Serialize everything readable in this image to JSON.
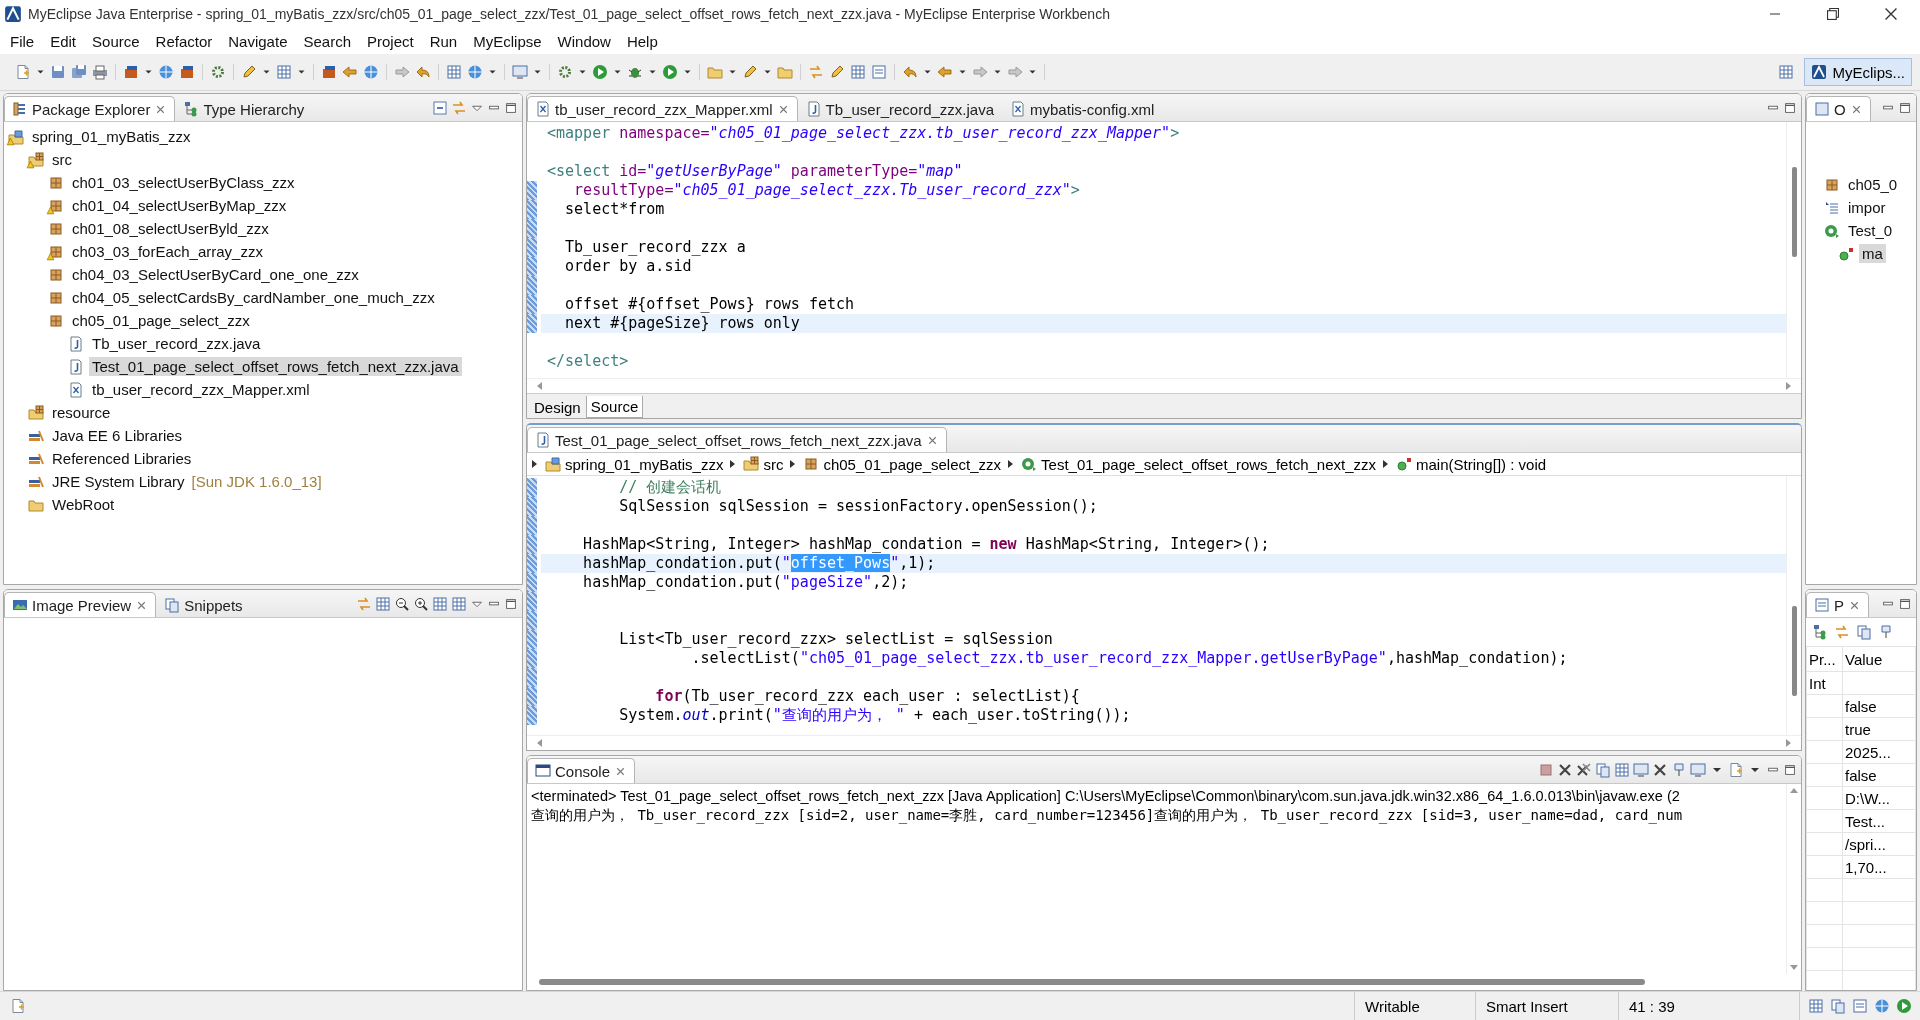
{
  "window": {
    "title": "MyEclipse Java Enterprise - spring_01_myBatis_zzx/src/ch05_01_page_select_zzx/Test_01_page_select_offset_rows_fetch_next_zzx.java - MyEclipse Enterprise Workbench"
  },
  "menu": [
    {
      "label": "File"
    },
    {
      "label": "Edit"
    },
    {
      "label": "Source"
    },
    {
      "label": "Refactor"
    },
    {
      "label": "Navigate"
    },
    {
      "label": "Search"
    },
    {
      "label": "Project"
    },
    {
      "label": "Run"
    },
    {
      "label": "MyEclipse"
    },
    {
      "label": "Window"
    },
    {
      "label": "Help"
    }
  ],
  "perspective": {
    "label": "MyEclips...",
    "selected": true
  },
  "explorer": {
    "tabs": [
      {
        "label": "Package Explorer",
        "kind": "explorer",
        "selected": true
      },
      {
        "label": "Type Hierarchy",
        "kind": "hierarchy",
        "selected": false
      }
    ],
    "tree": [
      {
        "label": "spring_01_myBatis_zzx",
        "kind": "project",
        "warning": true,
        "selected": false,
        "children": [
          {
            "label": "src",
            "kind": "srcfolder",
            "warning": true,
            "selected": false,
            "children": [
              {
                "label": "ch01_03_selectUserByClass_zzx",
                "kind": "package",
                "warning": false,
                "selected": false
              },
              {
                "label": "ch01_04_selectUserByMap_zzx",
                "kind": "package",
                "warning": true,
                "selected": false
              },
              {
                "label": "ch01_08_selectUserByld_zzx",
                "kind": "package",
                "warning": false,
                "selected": false
              },
              {
                "label": "ch03_03_forEach_array_zzx",
                "kind": "package",
                "warning": true,
                "selected": false
              },
              {
                "label": "ch04_03_SelectUserByCard_one_one_zzx",
                "kind": "package",
                "warning": false,
                "selected": false
              },
              {
                "label": "ch04_05_selectCardsBy_cardNamber_one_much_zzx",
                "kind": "package",
                "warning": false,
                "selected": false
              },
              {
                "label": "ch05_01_page_select_zzx",
                "kind": "package",
                "warning": false,
                "selected": false,
                "children": [
                  {
                    "label": "Tb_user_record_zzx.java",
                    "kind": "java",
                    "warning": false,
                    "selected": false
                  },
                  {
                    "label": "Test_01_page_select_offset_rows_fetch_next_zzx.java",
                    "kind": "java",
                    "warning": false,
                    "selected": true
                  },
                  {
                    "label": "tb_user_record_zzx_Mapper.xml",
                    "kind": "xml",
                    "warning": false,
                    "selected": false
                  }
                ]
              }
            ]
          },
          {
            "label": "resource",
            "kind": "srcfolder",
            "warning": false,
            "selected": false
          },
          {
            "label": "Java EE 6 Libraries",
            "kind": "library",
            "warning": false,
            "selected": false
          },
          {
            "label": "Referenced Libraries",
            "kind": "library",
            "warning": false,
            "selected": false
          },
          {
            "label": "JRE System Library",
            "decoration": "[Sun JDK 1.6.0_13]",
            "kind": "library",
            "warning": false,
            "selected": false
          },
          {
            "label": "WebRoot",
            "kind": "folder",
            "warning": false,
            "selected": false
          }
        ]
      }
    ]
  },
  "preview": {
    "tabs": [
      {
        "label": "Image Preview",
        "kind": "image",
        "selected": true
      },
      {
        "label": "Snippets",
        "kind": "snippets",
        "selected": false
      }
    ]
  },
  "xml_editor": {
    "tabs": [
      {
        "label": "tb_user_record_zzx_Mapper.xml",
        "kind": "xml",
        "selected": true
      },
      {
        "label": "Tb_user_record_zzx.java",
        "kind": "java",
        "selected": false
      },
      {
        "label": "mybatis-config.xml",
        "kind": "xml",
        "selected": false
      }
    ],
    "lines": [
      {
        "current": false,
        "changed": false,
        "tokens": [
          {
            "text": "<mapper",
            "kind": "tag"
          },
          {
            "text": " namespace=",
            "kind": "attr"
          },
          {
            "text": "\"ch05_01_page_select_zzx.tb_user_record_zzx_Mapper\"",
            "kind": "val"
          },
          {
            "text": ">",
            "kind": "tag"
          }
        ]
      },
      {
        "current": false,
        "changed": false
      },
      {
        "current": false,
        "changed": false,
        "tokens": [
          {
            "text": "<select",
            "kind": "tag"
          },
          {
            "text": " id=",
            "kind": "attr"
          },
          {
            "text": "\"getUserByPage\"",
            "kind": "val"
          },
          {
            "text": " parameterType=",
            "kind": "attr"
          },
          {
            "text": "\"map\"",
            "kind": "val"
          }
        ]
      },
      {
        "current": false,
        "changed": true,
        "tokens": [
          {
            "text": "   resultType=",
            "kind": "attr"
          },
          {
            "text": "\"ch05_01_page_select_zzx.Tb_user_record_zzx\"",
            "kind": "val"
          },
          {
            "text": ">",
            "kind": "tag"
          }
        ]
      },
      {
        "current": false,
        "changed": true,
        "tokens": [
          {
            "text": "  select*from",
            "kind": "plain"
          }
        ]
      },
      {
        "current": false,
        "changed": true
      },
      {
        "current": false,
        "changed": true,
        "tokens": [
          {
            "text": "  Tb_user_record_zzx a",
            "kind": "plain"
          }
        ]
      },
      {
        "current": false,
        "changed": true,
        "tokens": [
          {
            "text": "  order by a.sid",
            "kind": "plain"
          }
        ]
      },
      {
        "current": false,
        "changed": true
      },
      {
        "current": false,
        "changed": true,
        "tokens": [
          {
            "text": "  offset #{offset_Pows} rows fetch",
            "kind": "plain"
          }
        ]
      },
      {
        "current": true,
        "changed": true,
        "tokens": [
          {
            "text": "  next #{pageSize} rows only",
            "kind": "plain"
          }
        ]
      },
      {
        "current": false,
        "changed": false
      },
      {
        "current": false,
        "changed": false,
        "tokens": [
          {
            "text": "</select>",
            "kind": "tag"
          }
        ]
      }
    ],
    "views": [
      {
        "label": "Design",
        "selected": false
      },
      {
        "label": "Source",
        "selected": true
      }
    ]
  },
  "java_editor": {
    "tabs": [
      {
        "label": "Test_01_page_select_offset_rows_fetch_next_zzx.java",
        "kind": "java",
        "selected": true
      }
    ],
    "breadcrumb": [
      {
        "label": "spring_01_myBatis_zzx",
        "kind": "project"
      },
      {
        "label": "src",
        "kind": "srcfolder"
      },
      {
        "label": "ch05_01_page_select_zzx",
        "kind": "package"
      },
      {
        "label": "Test_01_page_select_offset_rows_fetch_next_zzx",
        "kind": "class"
      },
      {
        "label": "main(String[]) : void",
        "kind": "method"
      }
    ],
    "lines": [
      {
        "current": false,
        "changed": true,
        "tokens": [
          {
            "text": "        // 创建会话机",
            "kind": "comment"
          }
        ]
      },
      {
        "current": false,
        "changed": true,
        "tokens": [
          {
            "text": "        SqlSession sqlSession = sessionFactory.openSession();",
            "kind": "plain"
          }
        ]
      },
      {
        "current": false,
        "changed": true
      },
      {
        "current": false,
        "changed": true,
        "tokens": [
          {
            "text": "    HashMap<String, Integer> hashMap_condation = ",
            "kind": "plain"
          },
          {
            "text": "new",
            "kind": "kw"
          },
          {
            "text": " HashMap<String, Integer>();",
            "kind": "plain"
          }
        ]
      },
      {
        "current": true,
        "changed": true,
        "tokens": [
          {
            "text": "    hashMap_condation.put(",
            "kind": "plain"
          },
          {
            "text": "\"",
            "kind": "str"
          },
          {
            "text": "offset_Pows",
            "kind": "sel"
          },
          {
            "text": "\"",
            "kind": "str"
          },
          {
            "text": ",1);",
            "kind": "plain"
          }
        ]
      },
      {
        "current": false,
        "changed": true,
        "tokens": [
          {
            "text": "    hashMap_condation.put(",
            "kind": "plain"
          },
          {
            "text": "\"pageSize\"",
            "kind": "str"
          },
          {
            "text": ",2);",
            "kind": "plain"
          }
        ]
      },
      {
        "current": false,
        "changed": true
      },
      {
        "current": false,
        "changed": true
      },
      {
        "current": false,
        "changed": true,
        "tokens": [
          {
            "text": "        List<Tb_user_record_zzx> selectList = sqlSession",
            "kind": "plain"
          }
        ]
      },
      {
        "current": false,
        "changed": true,
        "tokens": [
          {
            "text": "                .selectList(",
            "kind": "plain"
          },
          {
            "text": "\"ch05_01_page_select_zzx.tb_user_record_zzx_Mapper.getUserByPage\"",
            "kind": "str"
          },
          {
            "text": ",hashMap_condation);",
            "kind": "plain"
          }
        ]
      },
      {
        "current": false,
        "changed": true
      },
      {
        "current": false,
        "changed": true,
        "tokens": [
          {
            "text": "            for",
            "kind": "kw"
          },
          {
            "text": "(Tb_user_record_zzx each_user : selectList){",
            "kind": "plain"
          }
        ]
      },
      {
        "current": false,
        "changed": true,
        "tokens": [
          {
            "text": "        System.",
            "kind": "plain"
          },
          {
            "text": "out",
            "kind": "field"
          },
          {
            "text": ".print(",
            "kind": "plain"
          },
          {
            "text": "\"查询的用户为， \"",
            "kind": "str"
          },
          {
            "text": " + each_user.toString());",
            "kind": "plain"
          }
        ]
      }
    ]
  },
  "console": {
    "tabs": [
      {
        "label": "Console",
        "kind": "console",
        "selected": true
      }
    ],
    "lines": [
      "<terminated> Test_01_page_select_offset_rows_fetch_next_zzx [Java Application] C:\\Users\\MyEclipse\\Common\\binary\\com.sun.java.jdk.win32.x86_64_1.6.0.013\\bin\\javaw.exe (2",
      "查询的用户为， Tb_user_record_zzx [sid=2, user_name=李胜, card_number=123456]查询的用户为， Tb_user_record_zzx [sid=3, user_name=dad, card_num"
    ]
  },
  "outline": {
    "tabs": [
      {
        "label": "O",
        "kind": "outline",
        "selected": true
      }
    ],
    "tree": [
      {
        "label": "ch05_0",
        "kind": "package",
        "warning": false,
        "selected": false
      },
      {
        "label": "impor",
        "kind": "imports",
        "warning": false,
        "selected": false
      },
      {
        "label": "Test_0",
        "kind": "class",
        "warning": false,
        "selected": false,
        "children": [
          {
            "label": "ma",
            "kind": "method",
            "warning": false,
            "selected": true
          }
        ]
      }
    ]
  },
  "properties": {
    "tabs": [
      {
        "label": "P",
        "kind": "properties",
        "selected": true
      }
    ],
    "columns": [
      "Pr...",
      "Value"
    ],
    "rows": [
      {
        "property": "Int"
      },
      {
        "value": "false"
      },
      {
        "value": "true"
      },
      {
        "value": "2025..."
      },
      {
        "value": "false"
      },
      {
        "value": "D:\\W..."
      },
      {
        "value": "Test..."
      },
      {
        "value": "/spri..."
      },
      {
        "value": "1,70..."
      }
    ]
  },
  "status_bar": {
    "mode": "Writable",
    "insert": "Smart Insert",
    "position": "41 : 39"
  }
}
